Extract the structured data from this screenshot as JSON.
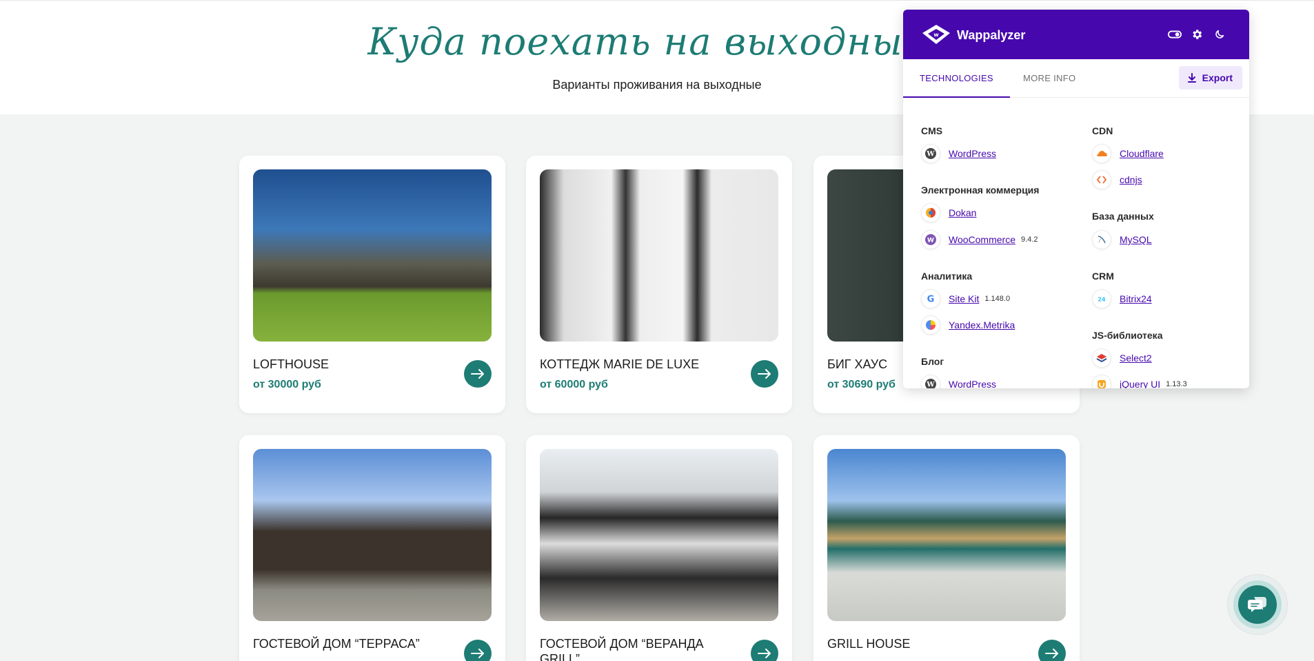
{
  "hero": {
    "title": "Куда поехать на выходные?",
    "subtitle": "Варианты проживания на выходные"
  },
  "cards": [
    {
      "title": "LOFTHOUSE",
      "price": "от 30000 руб"
    },
    {
      "title": "КОТТЕДЖ MARIE DE LUXE",
      "price": "от 60000 руб"
    },
    {
      "title": "БИГ ХАУС",
      "price": "от 30690 руб"
    },
    {
      "title": "ГОСТЕВОЙ ДОМ “ТЕРРАСА”",
      "price": ""
    },
    {
      "title": "ГОСТЕВОЙ ДОМ “ВЕРАНДА GRILL”",
      "price": ""
    },
    {
      "title": "GRILL HOUSE",
      "price": ""
    }
  ],
  "colors": {
    "accent": "#1d7c74",
    "wappalyzer": "#4608ad",
    "background": "#f2f3f3"
  },
  "wappalyzer": {
    "brand": "Wappalyzer",
    "tabs": [
      "TECHNOLOGIES",
      "MORE INFO"
    ],
    "export_label": "Export",
    "left_column": [
      {
        "category": "CMS",
        "items": [
          {
            "name": "WordPress",
            "version": "",
            "icon": "wordpress-icon"
          }
        ]
      },
      {
        "category": "Электронная коммерция",
        "items": [
          {
            "name": "Dokan",
            "version": "",
            "icon": "dokan-icon"
          },
          {
            "name": "WooCommerce",
            "version": "9.4.2",
            "icon": "woocommerce-icon"
          }
        ]
      },
      {
        "category": "Аналитика",
        "items": [
          {
            "name": "Site Kit",
            "version": "1.148.0",
            "icon": "google-icon"
          },
          {
            "name": "Yandex.Metrika",
            "version": "",
            "icon": "yandex-metrika-icon"
          }
        ]
      },
      {
        "category": "Блог",
        "items": [
          {
            "name": "WordPress",
            "version": "",
            "icon": "wordpress-icon"
          }
        ]
      }
    ],
    "right_column": [
      {
        "category": "CDN",
        "items": [
          {
            "name": "Cloudflare",
            "version": "",
            "icon": "cloudflare-icon"
          },
          {
            "name": "cdnjs",
            "version": "",
            "icon": "cdnjs-icon"
          }
        ]
      },
      {
        "category": "База данных",
        "items": [
          {
            "name": "MySQL",
            "version": "",
            "icon": "mysql-icon"
          }
        ]
      },
      {
        "category": "CRM",
        "items": [
          {
            "name": "Bitrix24",
            "version": "",
            "icon": "bitrix24-icon"
          }
        ]
      },
      {
        "category": "JS-библиотека",
        "items": [
          {
            "name": "Select2",
            "version": "",
            "icon": "select2-icon"
          },
          {
            "name": "jQuery UI",
            "version": "1.13.3",
            "icon": "jquery-ui-icon"
          }
        ]
      }
    ]
  }
}
